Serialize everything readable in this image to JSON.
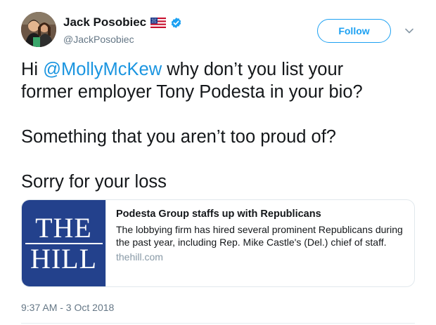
{
  "author": {
    "display_name": "Jack Posobiec",
    "handle": "@JackPosobiec",
    "flag_icon": "us-flag-icon",
    "verified_icon": "verified-badge-icon"
  },
  "actions": {
    "follow_label": "Follow",
    "more_icon": "chevron-down-icon"
  },
  "tweet": {
    "line1_prefix": "Hi ",
    "mention": "@MollyMcKew",
    "line1_suffix": " why don’t you list your",
    "line2": "former employer Tony Podesta in your bio?",
    "line3": "Something that you aren’t too proud of?",
    "line4": "Sorry for your loss"
  },
  "card": {
    "logo_line1": "THE",
    "logo_line2": "HILL",
    "title": "Podesta Group staffs up with Republicans",
    "description": "The  lobbying firm has hired several prominent Republicans during the past year, including Rep. Mike Castle's (Del.) chief of staff.",
    "domain": "thehill.com"
  },
  "timestamp": "9:37 AM - 3 Oct 2018",
  "colors": {
    "accent": "#1da1f2",
    "mention": "#1b95e0",
    "card_logo_bg": "#23418c",
    "secondary_text": "#657786"
  }
}
